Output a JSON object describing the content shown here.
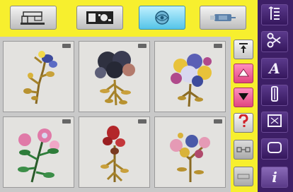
{
  "toolbar": {
    "buttons": [
      {
        "id": "embroidery-machine",
        "icon": "machine-icon",
        "active": false
      },
      {
        "id": "personal-designs",
        "icon": "folder-chip-icon",
        "active": false
      },
      {
        "id": "embroidery-designs",
        "icon": "design-globe-icon",
        "active": true
      },
      {
        "id": "usb-stick",
        "icon": "usb-icon",
        "active": false
      }
    ]
  },
  "designs": {
    "items": [
      {
        "name": "yellow-blue-flower-sprig",
        "colors": [
          "#c8a23a",
          "#3e4b9c",
          "#f2d84a"
        ]
      },
      {
        "name": "dark-flower-bouquet",
        "colors": [
          "#2f3140",
          "#c9a03c",
          "#b37a6c"
        ]
      },
      {
        "name": "multicolor-flower-bouquet",
        "colors": [
          "#e8c23a",
          "#5a5fb5",
          "#b04a8c"
        ]
      },
      {
        "name": "pink-rose-branch",
        "colors": [
          "#e07aa8",
          "#2e7d3a",
          "#d8d8f0"
        ]
      },
      {
        "name": "red-flower-stem",
        "colors": [
          "#b3262a",
          "#c9a03c",
          "#7a3a20"
        ]
      },
      {
        "name": "pink-blue-flower-spray",
        "colors": [
          "#e59ab5",
          "#4a5aa8",
          "#d9b33a"
        ]
      }
    ]
  },
  "side_buttons": [
    {
      "icon": "scroll-top-icon",
      "style": "normal"
    },
    {
      "icon": "scroll-up-icon",
      "style": "pink"
    },
    {
      "icon": "scroll-down-icon",
      "style": "pink"
    },
    {
      "icon": "help-icon",
      "style": "normal"
    },
    {
      "icon": "connect-icon",
      "style": "dim"
    },
    {
      "icon": "blank-icon",
      "style": "dim"
    }
  ],
  "right_panel": {
    "buttons": [
      {
        "icon": "edit-list-icon"
      },
      {
        "icon": "scissors-icon"
      },
      {
        "icon": "alphabet-icon",
        "label": "A"
      },
      {
        "icon": "thread-spool-icon"
      },
      {
        "icon": "hoop-icon"
      },
      {
        "icon": "embroidery-frame-icon"
      },
      {
        "icon": "info-icon",
        "label": "i",
        "selected": true
      }
    ]
  },
  "colors": {
    "toolbar_bg": "#f7ef2e",
    "panel_bg": "#3d1f66",
    "active_button": "#55c4e8",
    "pink_button": "#e0457f"
  }
}
